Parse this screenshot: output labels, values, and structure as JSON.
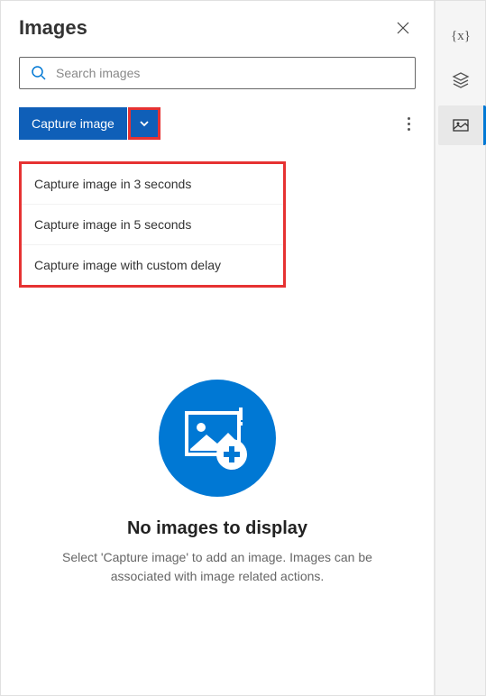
{
  "panel": {
    "title": "Images",
    "search_placeholder": "Search images"
  },
  "toolbar": {
    "capture_label": "Capture image"
  },
  "dropdown": {
    "items": [
      "Capture image in 3 seconds",
      "Capture image in 5 seconds",
      "Capture image with custom delay"
    ]
  },
  "empty": {
    "title": "No images to display",
    "desc": "Select 'Capture image' to add an image. Images can be associated with image related actions."
  },
  "sidebar": {
    "items": [
      {
        "icon": "variables",
        "active": false
      },
      {
        "icon": "layers",
        "active": false
      },
      {
        "icon": "images",
        "active": true
      }
    ]
  }
}
